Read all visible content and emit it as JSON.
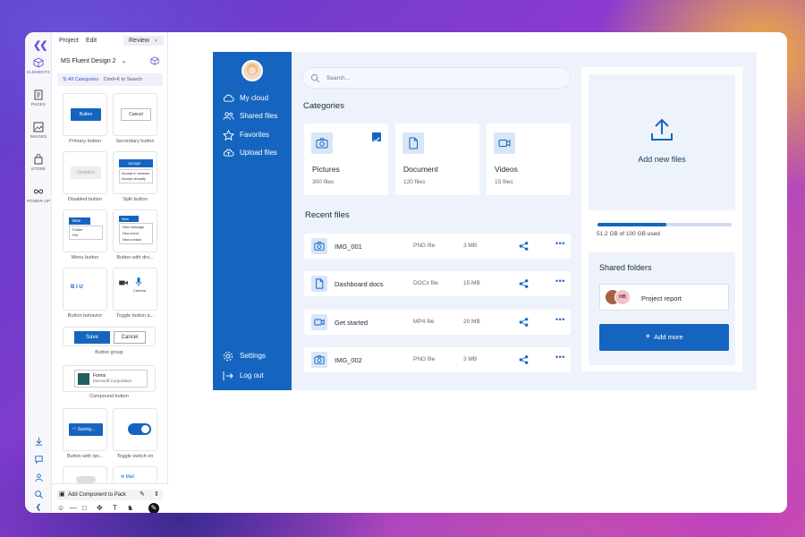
{
  "builder": {
    "tabs": {
      "project": "Project",
      "edit": "Edit",
      "review": "Review"
    },
    "rail": {
      "elements": "ELEMENTS",
      "pages": "PAGES",
      "images": "IMAGES",
      "store": "STORE",
      "power_up": "POWER-UP"
    },
    "library": "MS Fluent Design 2",
    "search": {
      "category": "All Categories",
      "hint": "Cmd+K to Search"
    },
    "components": [
      {
        "caption": "Primary button",
        "preview": "Button"
      },
      {
        "caption": "Secondary button",
        "preview": "Cancel"
      },
      {
        "caption": "Disabled button",
        "preview": "Disabled"
      },
      {
        "caption": "Split button",
        "preview": "Accept",
        "items": [
          "Accept in session",
          "Accept virtually"
        ]
      },
      {
        "caption": "Menu button",
        "preview": "New",
        "items": [
          "Folder",
          "File"
        ]
      },
      {
        "caption": "Button with dro...",
        "preview": "New",
        "items": [
          "New message",
          "New event",
          "New contact"
        ]
      },
      {
        "caption": "Button behavior",
        "preview": "B  I  U"
      },
      {
        "caption": "Toggle button a...",
        "preview": "Camera"
      },
      {
        "caption": "Button group",
        "save": "Save",
        "cancel": "Cancel"
      },
      {
        "caption": "Compound button",
        "title": "Forms",
        "sub": "Microsoft Corporation"
      },
      {
        "caption": "Button with spi...",
        "preview": "Saving..."
      },
      {
        "caption": "Toggle switch on"
      },
      {
        "caption": "",
        "preview": "Mail"
      }
    ],
    "footer": {
      "add_component": "Add Component to Pack"
    }
  },
  "app": {
    "nav": [
      {
        "label": "My cloud",
        "icon": "cloud-icon"
      },
      {
        "label": "Shared files",
        "icon": "users-icon"
      },
      {
        "label": "Favorites",
        "icon": "star-icon"
      },
      {
        "label": "Upload files",
        "icon": "upload-cloud-icon"
      }
    ],
    "nav_bottom": [
      {
        "label": "Settings",
        "icon": "gear-icon"
      },
      {
        "label": "Log out",
        "icon": "logout-icon"
      }
    ],
    "search_placeholder": "Search...",
    "categories_title": "Categories",
    "categories": [
      {
        "name": "Pictures",
        "count": "300 files",
        "icon": "camera-icon",
        "checked": true
      },
      {
        "name": "Document",
        "count": "120 files",
        "icon": "document-icon",
        "checked": false
      },
      {
        "name": "Videos",
        "count": "15 files",
        "icon": "video-icon",
        "checked": false
      }
    ],
    "recent_title": "Recent files",
    "recent_files": [
      {
        "name": "IMG_001",
        "type": "PNG file",
        "size": "3 MB",
        "icon": "camera-icon"
      },
      {
        "name": "Dashboard docs",
        "type": "DOCx file",
        "size": "15 MB",
        "icon": "document-icon"
      },
      {
        "name": "Get started",
        "type": "MP4 file",
        "size": "20 MB",
        "icon": "video-icon"
      },
      {
        "name": "IMG_002",
        "type": "PNG file",
        "size": "3 MB",
        "icon": "camera-icon"
      }
    ],
    "upload_label": "Add new files",
    "storage": {
      "used_text": "51.2 GB of 100 GB used",
      "fraction": 0.512
    },
    "shared_title": "Shared folders",
    "shared_folder": {
      "name": "Project report",
      "avatar_initials": "HB"
    },
    "add_more": "Add more",
    "colors": {
      "primary": "#1565c0",
      "surface": "#eef3fb",
      "icon_bg": "#d8e6f8"
    }
  }
}
